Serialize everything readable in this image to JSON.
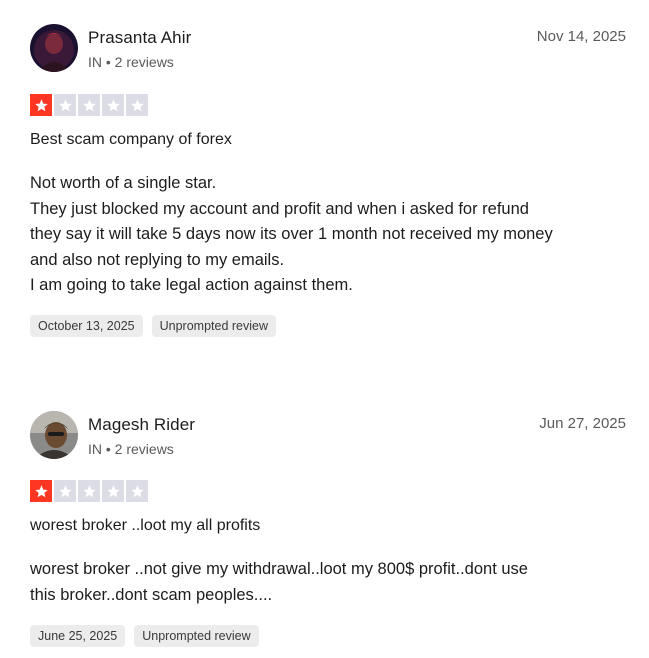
{
  "colors": {
    "star_active": "#ff3722",
    "star_inactive": "#dcdce6",
    "tag_bg": "#ececec"
  },
  "reviews": [
    {
      "name": "Prasanta Ahir",
      "meta": "IN • 2 reviews",
      "date": "Nov 14, 2025",
      "rating": 1,
      "title": "Best scam company of forex",
      "body": [
        "Not worth of a single star.",
        "They just blocked my account and profit and when i asked for refund",
        "they say it will take 5 days now its over 1 month not received my money",
        "and also not replying to my emails.",
        "I am going to take legal action against them."
      ],
      "experience_date": "October 13, 2025",
      "tag": "Unprompted review"
    },
    {
      "name": "Magesh Rider",
      "meta": "IN • 2 reviews",
      "date": "Jun 27, 2025",
      "rating": 1,
      "title": "worest broker ..loot my all profits",
      "body": [
        "worest broker ..not give my withdrawal..loot my 800$ profit..dont use",
        "this broker..dont scam peoples...."
      ],
      "experience_date": "June 25, 2025",
      "tag": "Unprompted review"
    }
  ]
}
